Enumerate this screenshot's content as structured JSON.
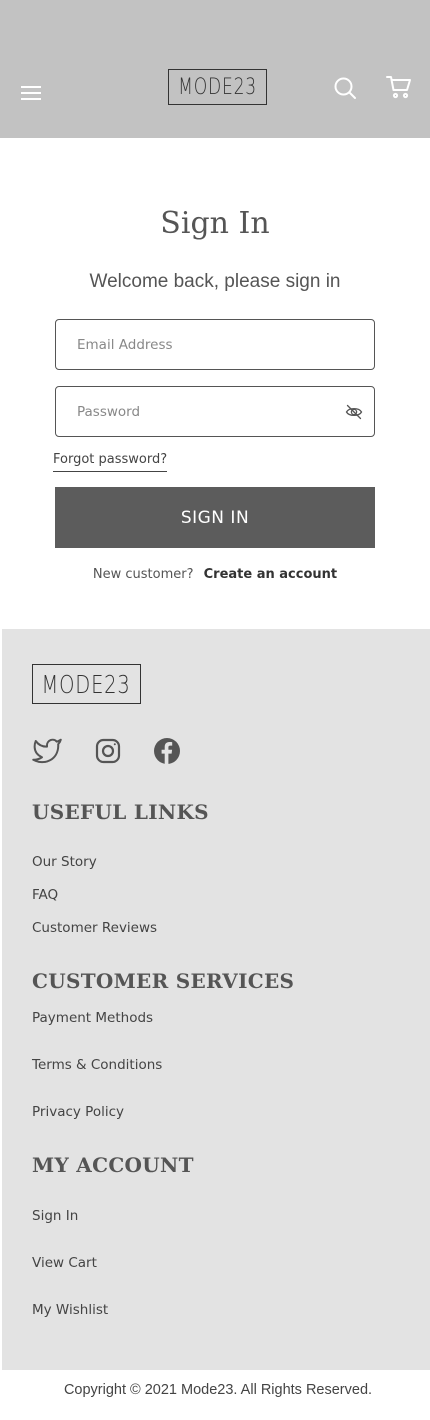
{
  "header": {
    "logo_text": "MODE23",
    "header_bg": "#c2c2c2",
    "icons": {
      "menu": "hamburger-menu-icon",
      "search": "search-icon",
      "cart": "cart-icon"
    }
  },
  "signin": {
    "title": "Sign In",
    "subtitle": "Welcome back, please sign in",
    "email_placeholder": "Email Address",
    "email_value": "",
    "password_placeholder": "Password",
    "password_value": "",
    "forgot_label": "Forgot password?",
    "button_label": "SIGN IN",
    "button_color": "#5c5c5c",
    "new_customer_text": "New customer?",
    "create_account_label": "Create an account"
  },
  "footer": {
    "logo_text": "MODE23",
    "footer_bg": "#e3e3e3",
    "social_icons": [
      "twitter-icon",
      "instagram-icon",
      "facebook-icon"
    ],
    "sections": [
      {
        "heading": "USEFUL LINKS",
        "links": [
          "Our Story",
          "FAQ",
          "Customer Reviews"
        ]
      },
      {
        "heading": "CUSTOMER SERVICES",
        "links": [
          "Payment Methods",
          "Terms & Conditions",
          "Privacy Policy"
        ]
      },
      {
        "heading": "MY ACCOUNT",
        "links": [
          "Sign In",
          "View Cart",
          "My Wishlist"
        ]
      }
    ]
  },
  "copyright": "Copyright © 2021 Mode23. All Rights Reserved."
}
